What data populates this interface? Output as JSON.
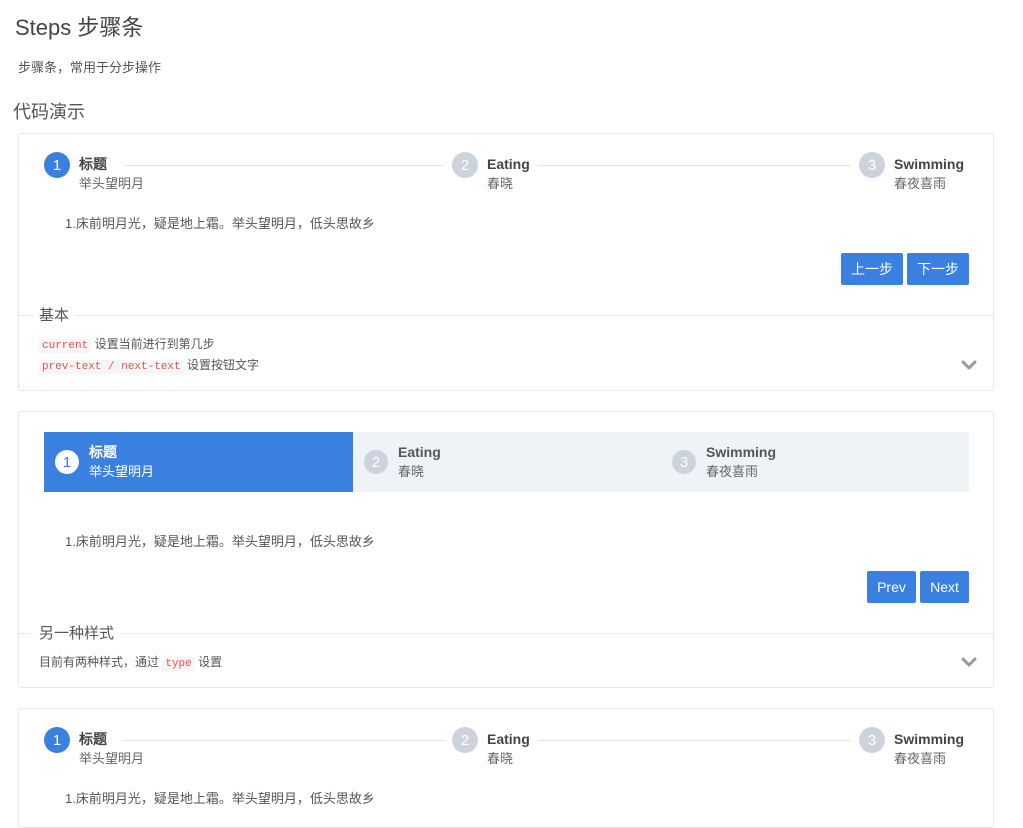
{
  "page": {
    "title": "Steps 步骤条",
    "description": "步骤条，常用于分步操作",
    "section_title": "代码演示"
  },
  "steps": [
    {
      "num": "1",
      "title": "标题",
      "desc": "举头望明月"
    },
    {
      "num": "2",
      "title": "Eating",
      "desc": "春晓"
    },
    {
      "num": "3",
      "title": "Swimming",
      "desc": "春夜喜雨"
    }
  ],
  "demo1": {
    "content": "1.床前明月光，疑是地上霜。举头望明月，低头思故乡",
    "prev_label": "上一步",
    "next_label": "下一步",
    "meta_title": "基本",
    "meta_lines": [
      {
        "code": "current",
        "text": "设置当前进行到第几步"
      },
      {
        "code": "prev-text / next-text",
        "text": "设置按钮文字"
      }
    ]
  },
  "demo2": {
    "content": "1.床前明月光，疑是地上霜。举头望明月，低头思故乡",
    "prev_label": "Prev",
    "next_label": "Next",
    "meta_title": "另一种样式",
    "meta_prefix": "目前有两种样式，通过",
    "meta_code": "type",
    "meta_suffix": "设置"
  },
  "demo3": {
    "content": "1.床前明月光，疑是地上霜。举头望明月，低头思故乡"
  },
  "colors": {
    "primary": "#3a80e0",
    "inactive": "#ccd3dd",
    "code": "#e8514b"
  },
  "icons": {
    "expand": "chevron-down-icon"
  },
  "current_step": 1
}
